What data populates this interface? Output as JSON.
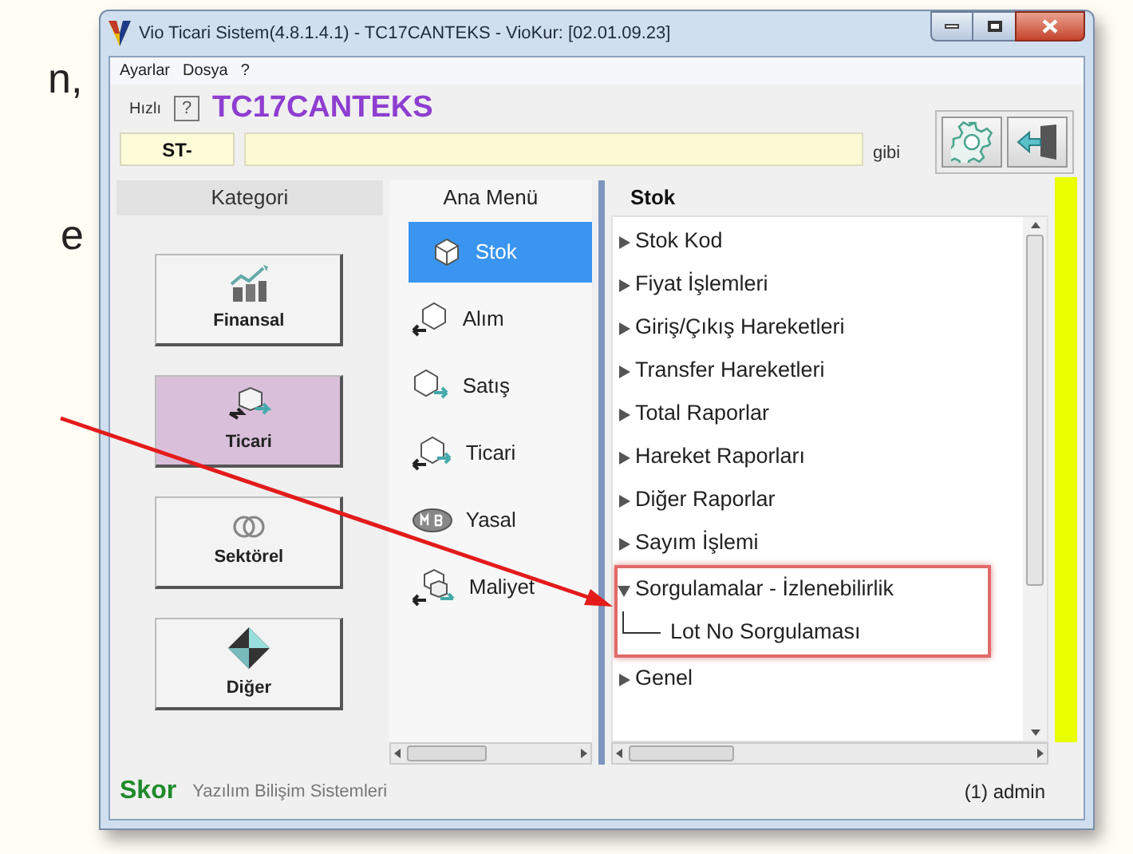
{
  "page_fragments": [
    "n,",
    "e"
  ],
  "window": {
    "title": "Vio Ticari Sistem(4.8.1.4.1)  - TC17CANTEKS - VioKur: [02.01.09.23]"
  },
  "menu": [
    "Ayarlar",
    "Dosya",
    "?"
  ],
  "toolbar": {
    "quick_label": "Hızlı",
    "help": "?",
    "company": "TC17CANTEKS",
    "code_value": "ST-",
    "suffix": "gibi"
  },
  "categories": {
    "header": "Kategori",
    "items": [
      {
        "label": "Finansal",
        "kind": "chart",
        "selected": false
      },
      {
        "label": "Ticari",
        "kind": "boxes",
        "selected": true
      },
      {
        "label": "Sektörel",
        "kind": "rings",
        "selected": false
      },
      {
        "label": "Diğer",
        "kind": "diamond",
        "selected": false
      }
    ]
  },
  "main_menu": {
    "header": "Ana Menü",
    "items": [
      {
        "label": "Stok",
        "kind": "box",
        "selected": true
      },
      {
        "label": "Alım",
        "kind": "box-in",
        "selected": false
      },
      {
        "label": "Satış",
        "kind": "box-out",
        "selected": false
      },
      {
        "label": "Ticari",
        "kind": "box-both",
        "selected": false
      },
      {
        "label": "Yasal",
        "kind": "badge",
        "selected": false
      },
      {
        "label": "Maliyet",
        "kind": "boxes",
        "selected": false
      }
    ]
  },
  "tree": {
    "header": "Stok",
    "items": [
      {
        "label": "Stok Kod",
        "expanded": false
      },
      {
        "label": "Fiyat İşlemleri",
        "expanded": false
      },
      {
        "label": "Giriş/Çıkış Hareketleri",
        "expanded": false
      },
      {
        "label": "Transfer Hareketleri",
        "expanded": false
      },
      {
        "label": "Total Raporlar",
        "expanded": false
      },
      {
        "label": "Hareket Raporları",
        "expanded": false
      },
      {
        "label": "Diğer Raporlar",
        "expanded": false
      },
      {
        "label": "Sayım İşlemi",
        "expanded": false
      },
      {
        "label": "Sorgulamalar - İzlenebilirlik",
        "expanded": true,
        "highlighted": true,
        "children": [
          {
            "label": "Lot No Sorgulaması"
          }
        ]
      },
      {
        "label": "Genel",
        "expanded": false
      }
    ]
  },
  "status_bar": {
    "brand": "Skor",
    "company": "Yazılım Bilişim Sistemleri",
    "user": "(1) admin"
  }
}
